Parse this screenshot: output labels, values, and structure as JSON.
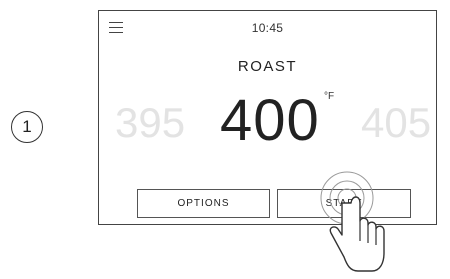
{
  "step": {
    "number": "1"
  },
  "status_bar": {
    "time": "10:45",
    "menu_icon": "hamburger-menu-icon"
  },
  "mode": {
    "title": "ROAST"
  },
  "temperature": {
    "previous": "395",
    "current": "400",
    "next": "405",
    "unit": "°F"
  },
  "buttons": {
    "options_label": "OPTIONS",
    "start_label": "START"
  },
  "gesture": {
    "icon": "tap-hand-icon"
  },
  "colors": {
    "ink": "#222222",
    "faded_number": "#e3e3e3",
    "border": "#444444"
  }
}
